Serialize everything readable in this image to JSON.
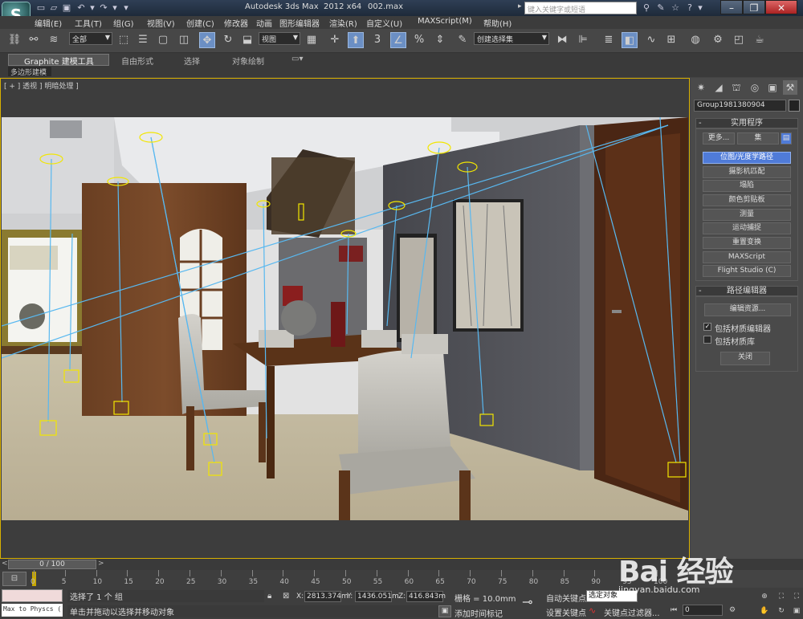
{
  "titlebar": {
    "app_title": "Autodesk 3ds Max  2012 x64",
    "file_name": "002.max",
    "search_placeholder": "键入关键字或短语",
    "logo_letter": "S"
  },
  "menu": {
    "items": [
      "编辑(E)",
      "工具(T)",
      "组(G)",
      "视图(V)",
      "创建(C)",
      "修改器",
      "动画",
      "图形编辑器",
      "渲染(R)",
      "自定义(U)",
      "MAXScript(M)",
      "帮助(H)"
    ]
  },
  "toolbar": {
    "selection_filter": "全部",
    "ref_coord": "视图",
    "named_selection": "创建选择集",
    "snap_angle_label": "3",
    "percent_label": "%"
  },
  "ribbon": {
    "tabs": [
      "Graphite 建模工具",
      "自由形式",
      "选择",
      "对象绘制"
    ],
    "sub_label": "多边形建模"
  },
  "viewport": {
    "label": "[ + ] 透视 ] 明暗处理 ]"
  },
  "command_panel": {
    "object_name": "Group1981380904",
    "utilities_title": "实用程序",
    "more_label": "更多...",
    "sets_label": "集",
    "utilities": [
      "位图/光度学路径",
      "摄影机匹配",
      "塌陷",
      "颜色剪贴板",
      "测量",
      "运动捕捉",
      "重置变换",
      "MAXScript",
      "Flight Studio (C)"
    ],
    "selected_utility": 0,
    "path_editor_title": "路径编辑器",
    "edit_resources": "编辑资源...",
    "include_material_editor": "包括材质编辑器",
    "include_material_library": "包括材质库",
    "close_label": "关闭",
    "include_material_editor_checked": true,
    "include_material_library_checked": false
  },
  "timeline": {
    "slider_label": "0 / 100",
    "ticks": [
      "0",
      "5",
      "10",
      "15",
      "20",
      "25",
      "30",
      "35",
      "40",
      "45",
      "50",
      "55",
      "60",
      "65",
      "70",
      "75",
      "80",
      "85",
      "90",
      "95",
      "100"
    ]
  },
  "status": {
    "maxscript_text": "Max to Physcs (",
    "selection_text": "选择了 1 个 组",
    "prompt_text": "单击并拖动以选择并移动对象",
    "x_label": "X:",
    "x_value": "2813.374m",
    "y_label": "Y:",
    "y_value": "1436.051m",
    "z_label": "Z:",
    "z_value": "416.843m",
    "grid_text": "栅格 = 10.0mm",
    "auto_key": "自动关键点",
    "set_key": "设置关键点",
    "key_mode": "选定对象",
    "key_filters": "关键点过滤器...",
    "add_time_tag": "添加时间标记",
    "frame_value": "0"
  },
  "watermark": {
    "text": "Bai 经验",
    "sub": "jingyan.baidu.com"
  },
  "colors": {
    "viewport_border": "#d8b000",
    "selected_button": "#4f7bd8",
    "light_gizmo": "#f2e600",
    "light_ray": "#58b8f0"
  }
}
